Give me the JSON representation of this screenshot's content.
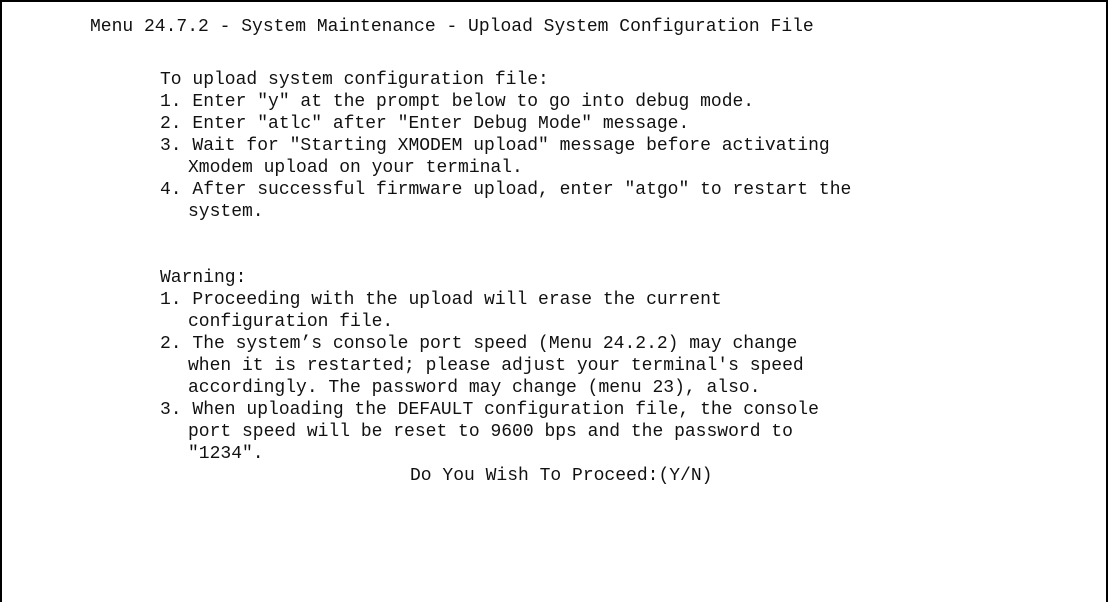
{
  "screen": {
    "title": "Menu 24.7.2 - System Maintenance - Upload System Configuration File",
    "instructions_heading": "To upload system configuration file:",
    "instructions": [
      "1. Enter \"y\" at the prompt below to go into debug mode.",
      "2. Enter \"atlc\" after \"Enter Debug Mode\" message.",
      "3. Wait for \"Starting XMODEM upload\" message before activating",
      "Xmodem upload on your terminal.",
      "4. After successful firmware upload, enter \"atgo\" to restart the",
      "system."
    ],
    "warning_heading": "Warning:",
    "warnings": [
      "1. Proceeding with the upload will erase the current",
      "configuration file.",
      "2. The system’s console port speed (Menu 24.2.2) may change",
      "when it is restarted; please adjust your terminal's speed",
      "accordingly. The password may change (menu 23), also.",
      "3. When uploading the DEFAULT configuration file, the console",
      "port speed will be reset to 9600 bps and the password to",
      "\"1234\"."
    ],
    "prompt": "Do You Wish To Proceed:(Y/N)"
  }
}
